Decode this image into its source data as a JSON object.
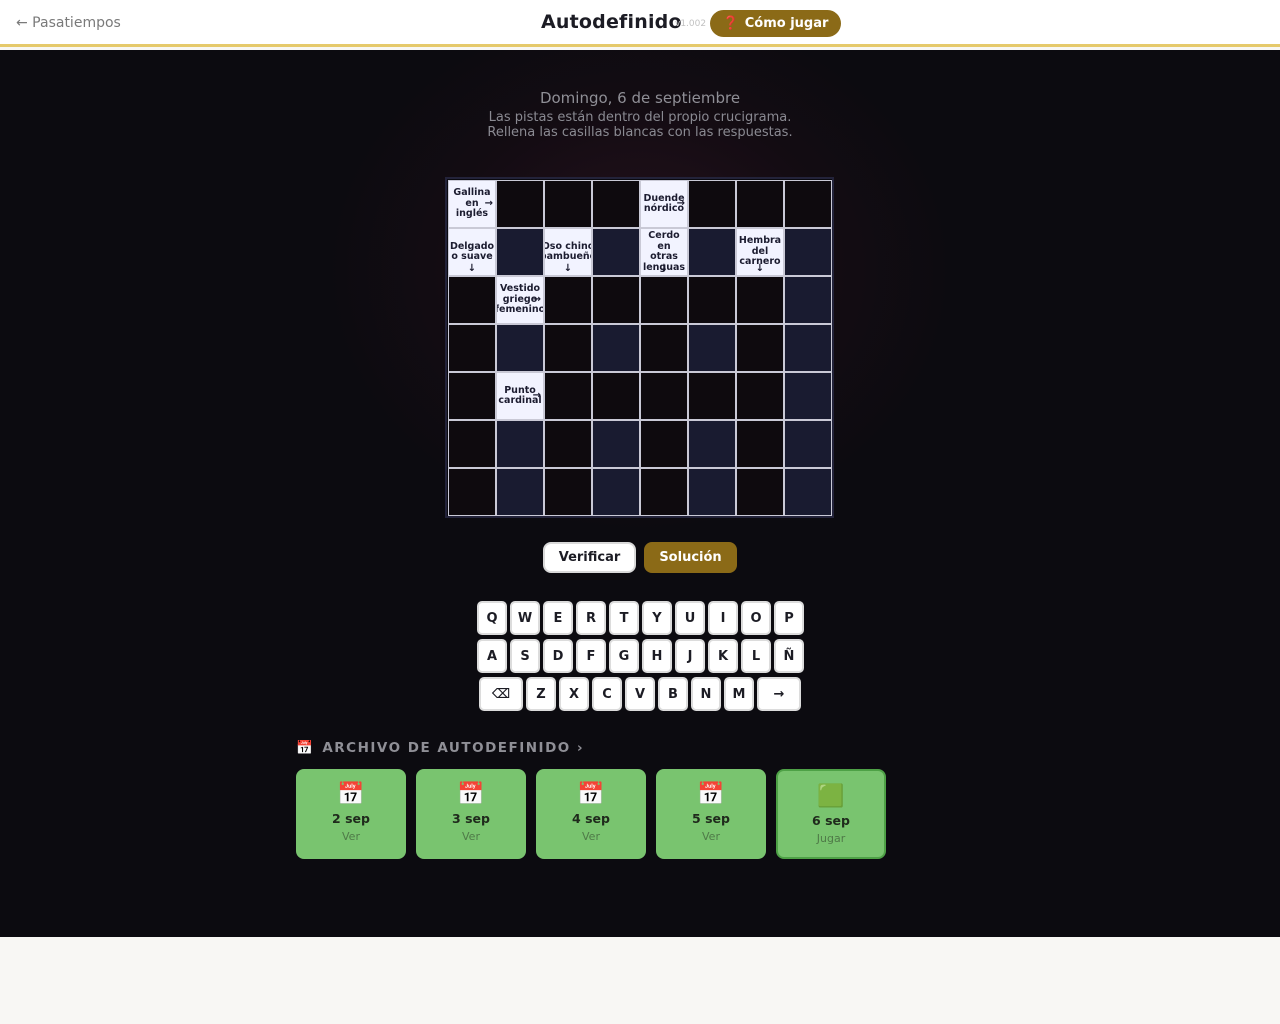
{
  "header": {
    "back_label": "← Pasatiempos",
    "title": "Autodefinido",
    "version": "v1.002",
    "howto_icon": "❓",
    "howto_label": "Cómo jugar"
  },
  "puzzle": {
    "date": "Domingo, 6 de septiembre",
    "instruction_1": "Las pistas están dentro del propio crucigrama.",
    "instruction_2": "Rellena las casillas blancas con las respuestas.",
    "clues": {
      "gallina": {
        "text": "Gallina en inglés",
        "arrow": "→"
      },
      "duende": {
        "text": "Duende nórdico",
        "arrow": "→"
      },
      "delgado": {
        "text": "Delgado o suave",
        "arrow": "↓"
      },
      "oso": {
        "text": "Oso chino bambueño",
        "arrow": "↓"
      },
      "cerdo": {
        "text": "Cerdo en otras lenguas",
        "arrow": "↓"
      },
      "hembra": {
        "text": "Hembra del carnero",
        "arrow": "↓"
      },
      "vestido": {
        "text": "Vestido griego femenino",
        "arrow": "→"
      },
      "punto": {
        "text": "Punto cardinal",
        "arrow": "→"
      }
    }
  },
  "actions": {
    "verify_label": "Verificar",
    "solution_label": "Solución"
  },
  "keyboard": {
    "row1": [
      "Q",
      "W",
      "E",
      "R",
      "T",
      "Y",
      "U",
      "I",
      "O",
      "P"
    ],
    "row2": [
      "A",
      "S",
      "D",
      "F",
      "G",
      "H",
      "J",
      "K",
      "L",
      "Ñ"
    ],
    "row3": [
      "Z",
      "X",
      "C",
      "V",
      "B",
      "N",
      "M"
    ],
    "backspace": "⌫",
    "next": "→"
  },
  "archive": {
    "icon": "📅",
    "title": "ARCHIVO DE AUTODEFINIDO ›",
    "cards": [
      {
        "icon": "📅",
        "date": "2 sep",
        "action": "Ver"
      },
      {
        "icon": "📅",
        "date": "3 sep",
        "action": "Ver"
      },
      {
        "icon": "📅",
        "date": "4 sep",
        "action": "Ver"
      },
      {
        "icon": "📅",
        "date": "5 sep",
        "action": "Ver"
      },
      {
        "icon": "🟩",
        "date": "6 sep",
        "action": "Jugar"
      }
    ]
  }
}
